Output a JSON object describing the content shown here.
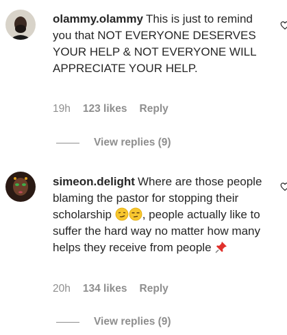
{
  "comments": [
    {
      "username": "olammy.olammy",
      "text": "This is just to remind you that NOT EVERYONE DESERVES YOUR HELP & NOT EVERYONE WILL APPRECIATE YOUR HELP.",
      "time": "19h",
      "likes": "123 likes",
      "reply": "Reply",
      "view_replies": "View replies (9)",
      "avatar_icon": "avatar-man-beard"
    },
    {
      "username": "simeon.delight",
      "text_before_emoji": "Where are those people blaming the pastor for stopping their scholarship",
      "text_after_emoji": ", people actually like to suffer the hard way no matter how many helps they receive from people",
      "emojis_inline": [
        "smirk-emoji",
        "unamused-emoji"
      ],
      "emoji_end": "pushpin-emoji",
      "time": "20h",
      "likes": "134 likes",
      "reply": "Reply",
      "view_replies": "View replies (9)",
      "avatar_icon": "avatar-woman-green"
    }
  ],
  "colors": {
    "text": "#262626",
    "secondary": "#8e8e8e",
    "emoji_yellow": "#f7c62f",
    "pin_red": "#e0312c"
  }
}
